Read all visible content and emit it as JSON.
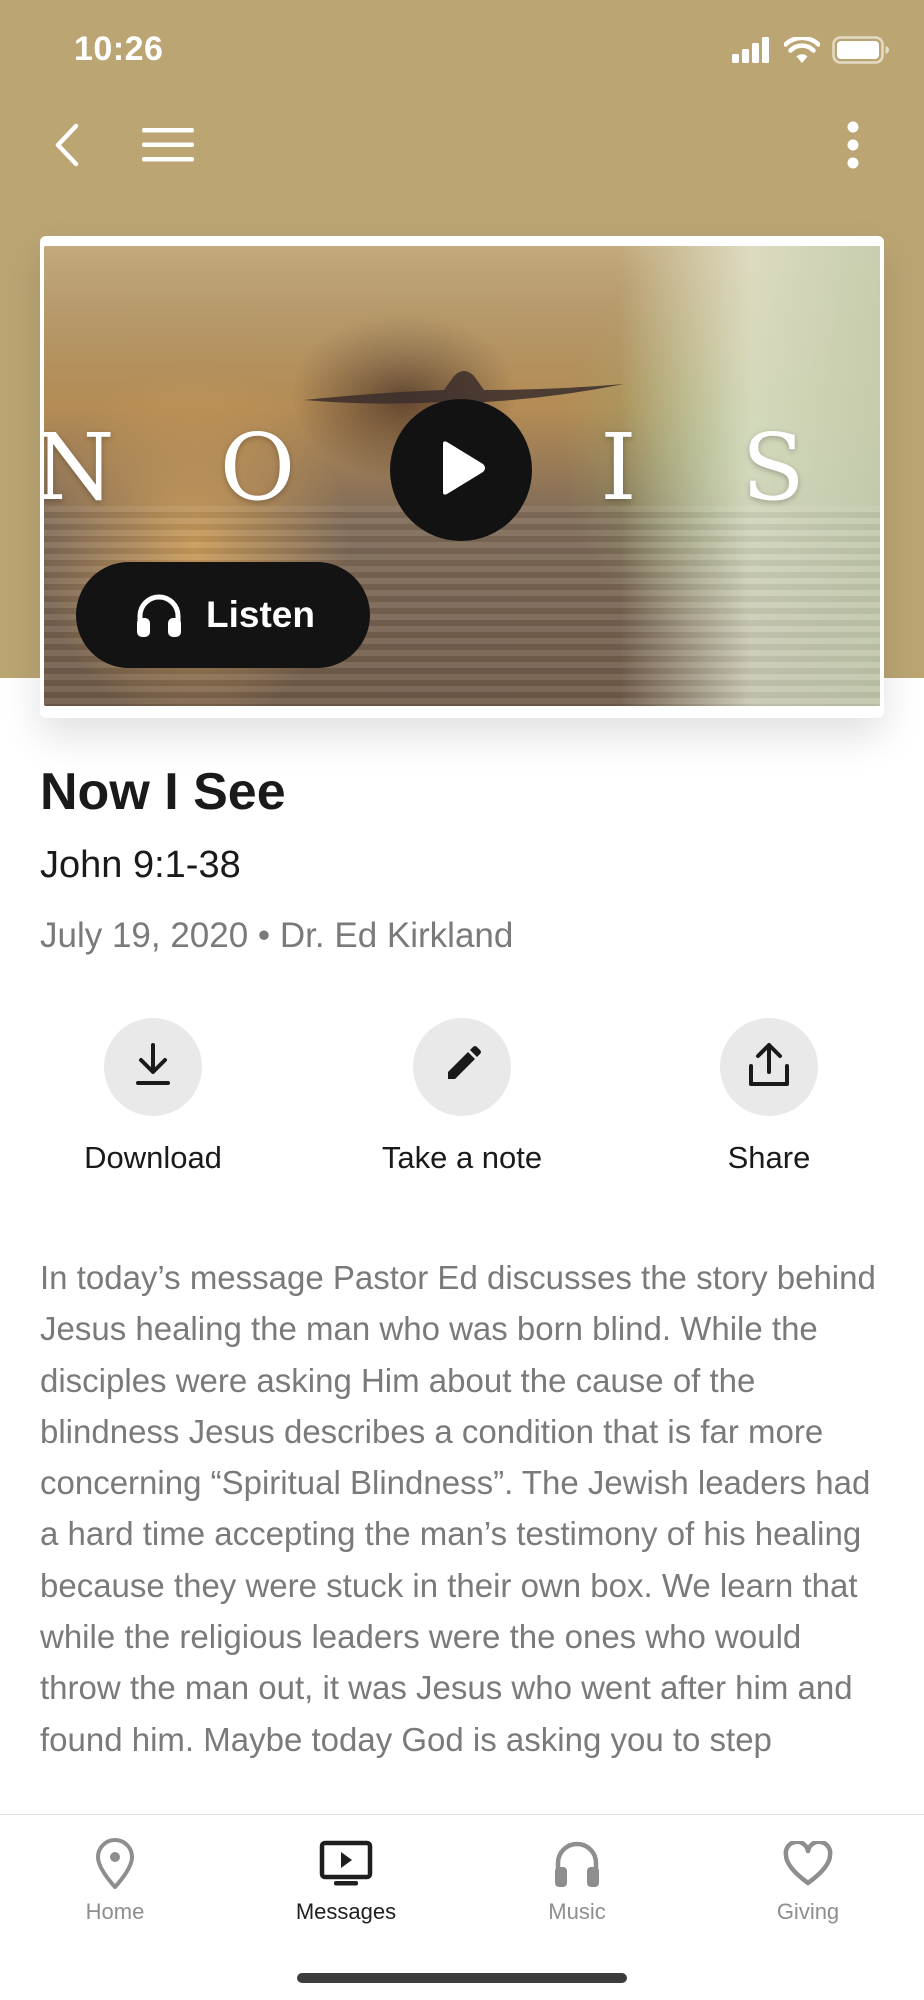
{
  "status_bar": {
    "time": "10:26"
  },
  "colors": {
    "header_bg": "#bba573",
    "text_primary": "#1a1a1a",
    "text_secondary": "#7a7a7a",
    "tab_inactive": "#8e8e8e",
    "action_circle_bg": "#e9e9e9"
  },
  "nav": {
    "back_icon": "chevron-left-icon",
    "menu_icon": "hamburger-menu-icon",
    "more_icon": "vertical-dots-icon"
  },
  "media": {
    "art_title": "N O W  I  S E E",
    "play_icon": "play-icon",
    "listen_label": "Listen",
    "listen_icon": "headphones-icon"
  },
  "sermon": {
    "title": "Now I See",
    "scripture": "John 9:1-38",
    "meta": "July 19, 2020 • Dr. Ed Kirkland",
    "description": "In today’s message Pastor Ed discusses the story behind Jesus healing the man who was born blind. While the disciples were asking Him about the cause of the blindness Jesus describes a condition that is far more concerning “Spiritual Blindness”. The Jewish leaders had a hard time accepting the man’s testimony of his healing because they were stuck in their own box. We learn that while the religious leaders were the ones who would throw the man out, it was Jesus who went after him and found him. Maybe today God is asking you to step"
  },
  "actions": [
    {
      "label": "Download",
      "icon": "download-icon"
    },
    {
      "label": "Take a note",
      "icon": "pencil-icon"
    },
    {
      "label": "Share",
      "icon": "share-icon"
    }
  ],
  "tabs": [
    {
      "label": "Home",
      "icon": "location-pin-icon",
      "active": false
    },
    {
      "label": "Messages",
      "icon": "tv-play-icon",
      "active": true
    },
    {
      "label": "Music",
      "icon": "headphones-icon",
      "active": false
    },
    {
      "label": "Giving",
      "icon": "heart-icon",
      "active": false
    }
  ]
}
